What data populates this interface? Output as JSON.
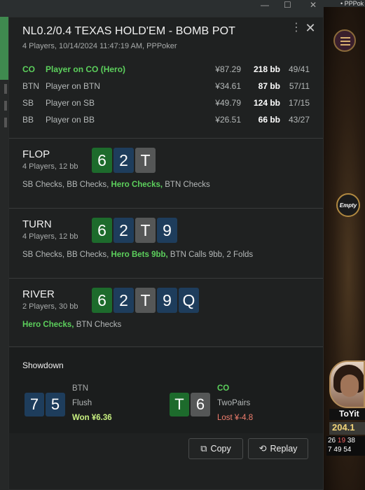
{
  "app": {
    "brand": "PPPok"
  },
  "title": "NL0.2/0.4 TEXAS HOLD'EM - BOMB POT",
  "subtitle": "4 Players, 10/14/2024 11:47:19 AM, PPPoker",
  "players": [
    {
      "pos": "CO",
      "name": "Player on CO (Hero)",
      "money": "¥87.29",
      "bb": "218 bb",
      "stat": "49/41",
      "hero": true
    },
    {
      "pos": "BTN",
      "name": "Player on BTN",
      "money": "¥34.61",
      "bb": "87 bb",
      "stat": "57/11",
      "hero": false
    },
    {
      "pos": "SB",
      "name": "Player on SB",
      "money": "¥49.79",
      "bb": "124 bb",
      "stat": "17/15",
      "hero": false
    },
    {
      "pos": "BB",
      "name": "Player on BB",
      "money": "¥26.51",
      "bb": "66 bb",
      "stat": "43/27",
      "hero": false
    }
  ],
  "streets": [
    {
      "name": "FLOP",
      "info": "4 Players, 12 bb",
      "cards": [
        {
          "rank": "6",
          "suit": "club"
        },
        {
          "rank": "2",
          "suit": "diamond"
        },
        {
          "rank": "T",
          "suit": "spade"
        }
      ],
      "actions_pre": "SB Checks, BB Checks, ",
      "actions_hero": "Hero Checks,",
      "actions_post": " BTN Checks"
    },
    {
      "name": "TURN",
      "info": "4 Players, 12 bb",
      "cards": [
        {
          "rank": "6",
          "suit": "club"
        },
        {
          "rank": "2",
          "suit": "diamond"
        },
        {
          "rank": "T",
          "suit": "spade"
        },
        {
          "rank": "9",
          "suit": "diamond"
        }
      ],
      "actions_pre": "SB Checks, BB Checks, ",
      "actions_hero": "Hero Bets 9bb,",
      "actions_post": " BTN Calls 9bb, 2 Folds"
    },
    {
      "name": "RIVER",
      "info": "2 Players, 30 bb",
      "cards": [
        {
          "rank": "6",
          "suit": "club"
        },
        {
          "rank": "2",
          "suit": "diamond"
        },
        {
          "rank": "T",
          "suit": "spade"
        },
        {
          "rank": "9",
          "suit": "diamond"
        },
        {
          "rank": "Q",
          "suit": "diamond"
        }
      ],
      "actions_pre": "",
      "actions_hero": "Hero Checks,",
      "actions_post": " BTN Checks"
    }
  ],
  "showdown": {
    "title": "Showdown",
    "hands": [
      {
        "player": "BTN",
        "hand": "Flush",
        "result": "Won ¥6.36",
        "cards": [
          {
            "rank": "7",
            "suit": "diamond"
          },
          {
            "rank": "5",
            "suit": "diamond"
          }
        ],
        "player_color": "#a8abab",
        "result_color": "#c8f080"
      },
      {
        "player": "CO",
        "hand": "TwoPairs",
        "result": "Lost ¥-4.8",
        "cards": [
          {
            "rank": "T",
            "suit": "club"
          },
          {
            "rank": "6",
            "suit": "spade"
          }
        ],
        "player_color": "#5cd05c",
        "result_color": "#f07e6e"
      }
    ]
  },
  "buttons": {
    "copy": "Copy",
    "replay": "Replay"
  },
  "background": {
    "empty_seat": "Empty",
    "player_name": "ToYit",
    "player_stack": "204.1",
    "stats_row1": [
      "26",
      "19",
      "38"
    ],
    "stats_row2": [
      "7",
      "49",
      "54"
    ]
  },
  "icons": {
    "more": "more-vertical-icon",
    "close": "close-icon",
    "copy": "copy-icon",
    "replay": "replay-icon",
    "menu": "hamburger-menu-icon"
  },
  "colors": {
    "hero": "#5cd05c",
    "club": "#1d6b2c",
    "spade": "#555757",
    "diamond": "#1e3d5c"
  }
}
